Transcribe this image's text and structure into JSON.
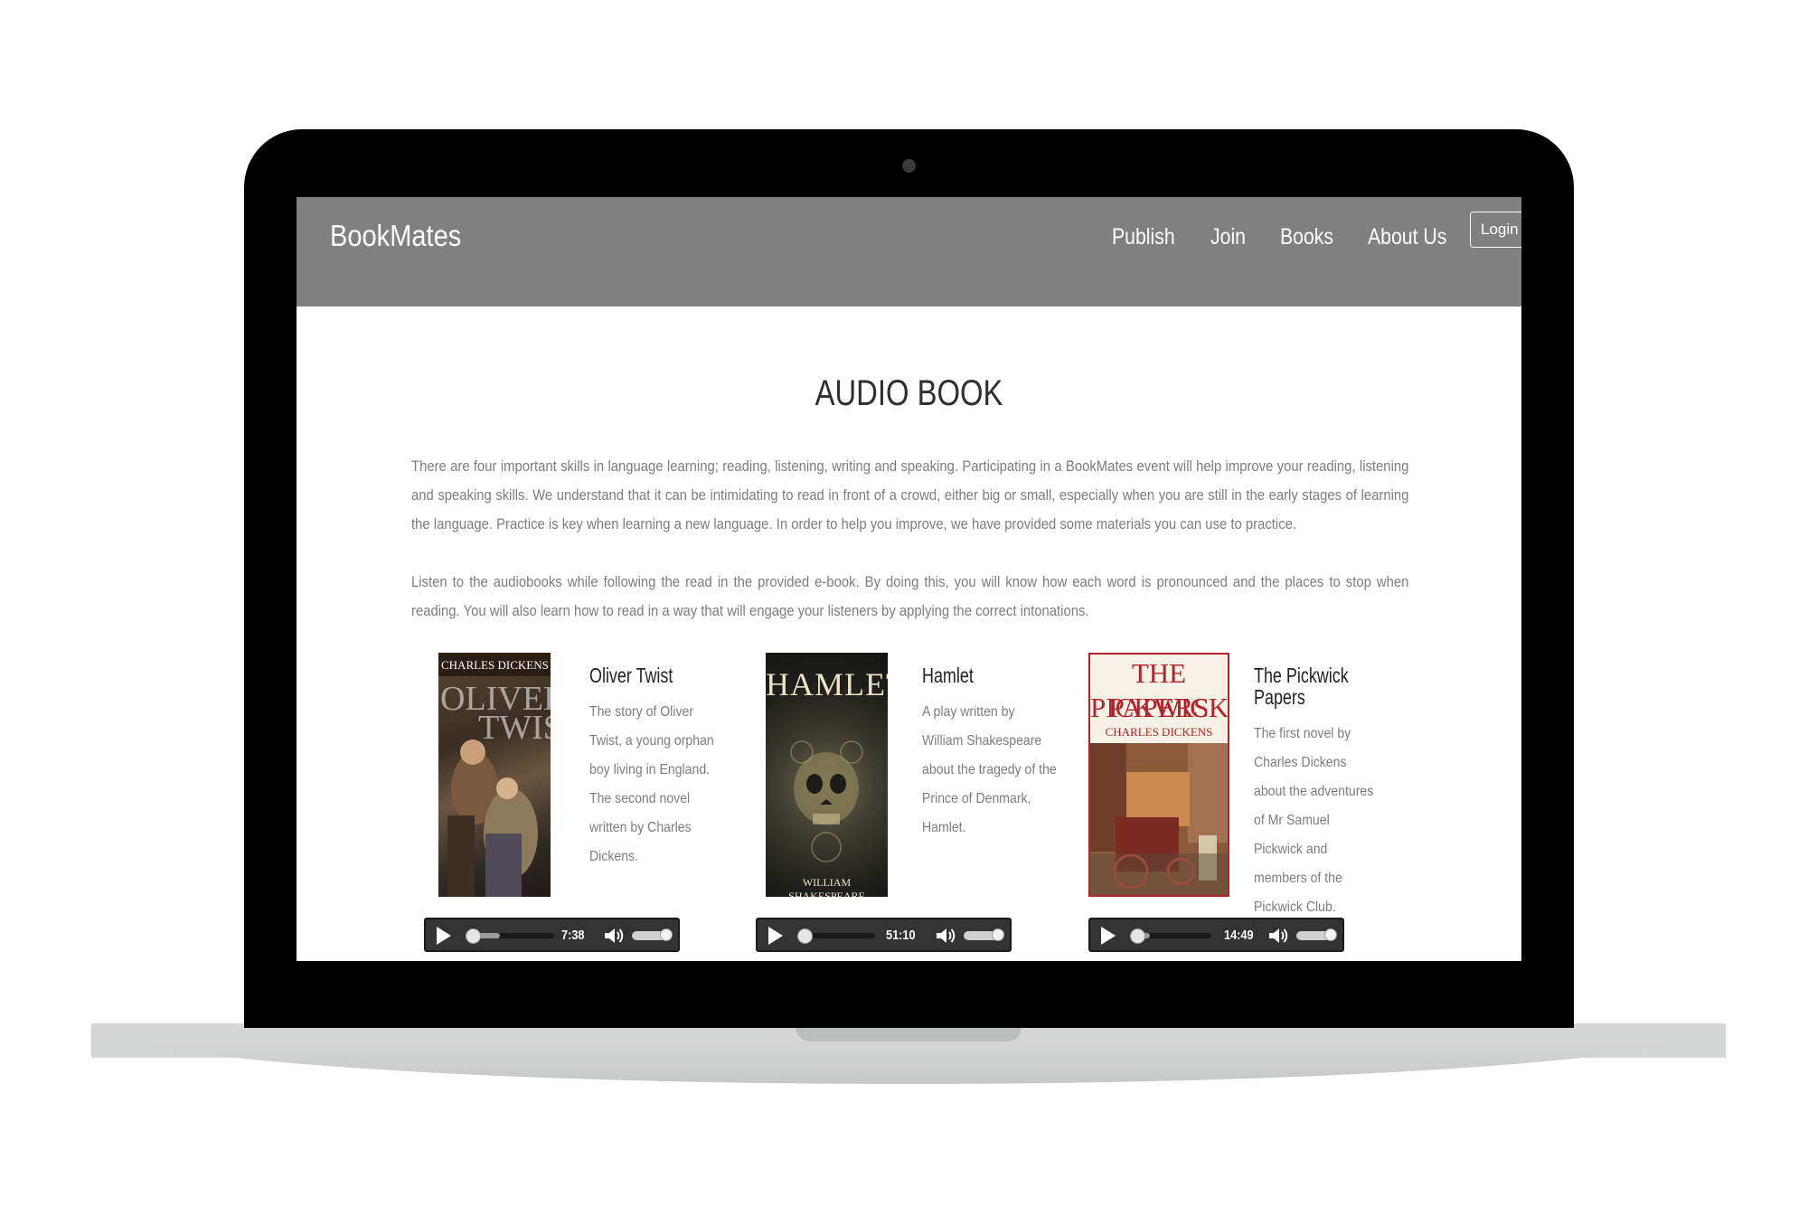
{
  "site": {
    "brand": "BookMates",
    "nav": [
      "Publish",
      "Join",
      "Books",
      "About Us"
    ],
    "login_label": "Login"
  },
  "page": {
    "title": "AUDIO BOOK",
    "paragraph1": "There are four important skills in language learning; reading, listening, writing and speaking. Participating in a BookMates event will help improve your reading, listening and speaking skills. We understand that it can be intimidating to read in front of a crowd, either big or small, especially when you are still in the early stages of learning the language. Practice is key when learning a new language. In order to help you improve, we have provided some materials you can use to practice.",
    "paragraph2": "Listen to the audiobooks while following the read in the provided e-book. By doing this, you will know how each word is pronounced and the places to stop when reading. You will also learn how to read in a way that will engage your listeners by applying the correct intonations."
  },
  "books": [
    {
      "title": "Oliver Twist",
      "description": "The story of Oliver Twist, a young orphan boy living in England. The second novel written by Charles Dickens.",
      "cover_author": "CHARLES DICKENS",
      "cover_title_line1": "OLIVER",
      "cover_title_line2": "TWIST",
      "duration": "7:38",
      "progress": 0.0,
      "volume": 0.85
    },
    {
      "title": "Hamlet",
      "description": "A play written by William Shakespeare about the tragedy of the Prince of Denmark, Hamlet.",
      "cover_title": "HAMLET",
      "cover_author": "WILLIAM SHAKESPEARE",
      "duration": "51:10",
      "progress": 0.0,
      "volume": 0.85
    },
    {
      "title": "The Pickwick Papers",
      "description": "The first novel by Charles Dickens about the adventures of Mr Samuel Pickwick and members of the Pickwick Club.",
      "cover_title_line1": "THE PICKWICK",
      "cover_title_line2": "PAPERS",
      "cover_author": "CHARLES DICKENS",
      "duration": "14:49",
      "progress": 0.0,
      "volume": 0.85
    }
  ],
  "colors": {
    "header_bg": "#808080",
    "player_bg": "#333333",
    "body_text": "#7d7d7d"
  }
}
